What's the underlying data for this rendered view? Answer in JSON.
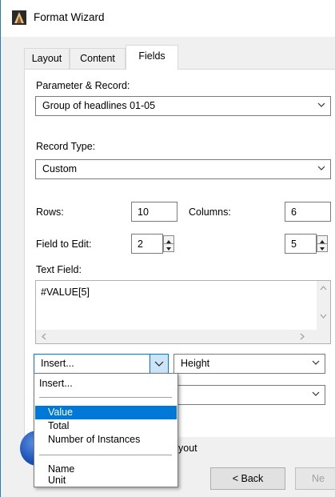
{
  "window": {
    "title": "Format Wizard",
    "icon": "wizard-hat-icon"
  },
  "tabs": [
    {
      "label": "Layout",
      "active": false
    },
    {
      "label": "Content",
      "active": false
    },
    {
      "label": "Fields",
      "active": true
    }
  ],
  "parameter_record": {
    "label": "Parameter & Record:",
    "value": "Group of headlines 01-05"
  },
  "record_type": {
    "label": "Record Type:",
    "value": "Custom"
  },
  "rows": {
    "label": "Rows:",
    "value": "10"
  },
  "columns": {
    "label": "Columns:",
    "value": "6"
  },
  "field_to_edit": {
    "label": "Field to Edit:",
    "row_value": "2",
    "col_value": "5"
  },
  "text_field": {
    "label": "Text Field:",
    "value": "#VALUE[5]"
  },
  "insert_combo": {
    "value": "Insert...",
    "options": [
      {
        "label": "Insert...",
        "selected": false
      },
      {
        "label": "Value",
        "selected": true
      },
      {
        "label": "Total",
        "selected": false
      },
      {
        "label": "Number of Instances",
        "selected": false
      },
      {
        "label": "Name",
        "selected": false
      },
      {
        "label": "Unit",
        "selected": false
      }
    ]
  },
  "height_combo": {
    "value": "Height"
  },
  "second_combo": {
    "value": ""
  },
  "layout_option": {
    "label_fragment": "yout"
  },
  "buttons": {
    "back": "< Back",
    "next": "Ne"
  },
  "colors": {
    "accent": "#0078d7",
    "window_border": "#2b79c2",
    "selection_bg": "#cce4f7"
  }
}
